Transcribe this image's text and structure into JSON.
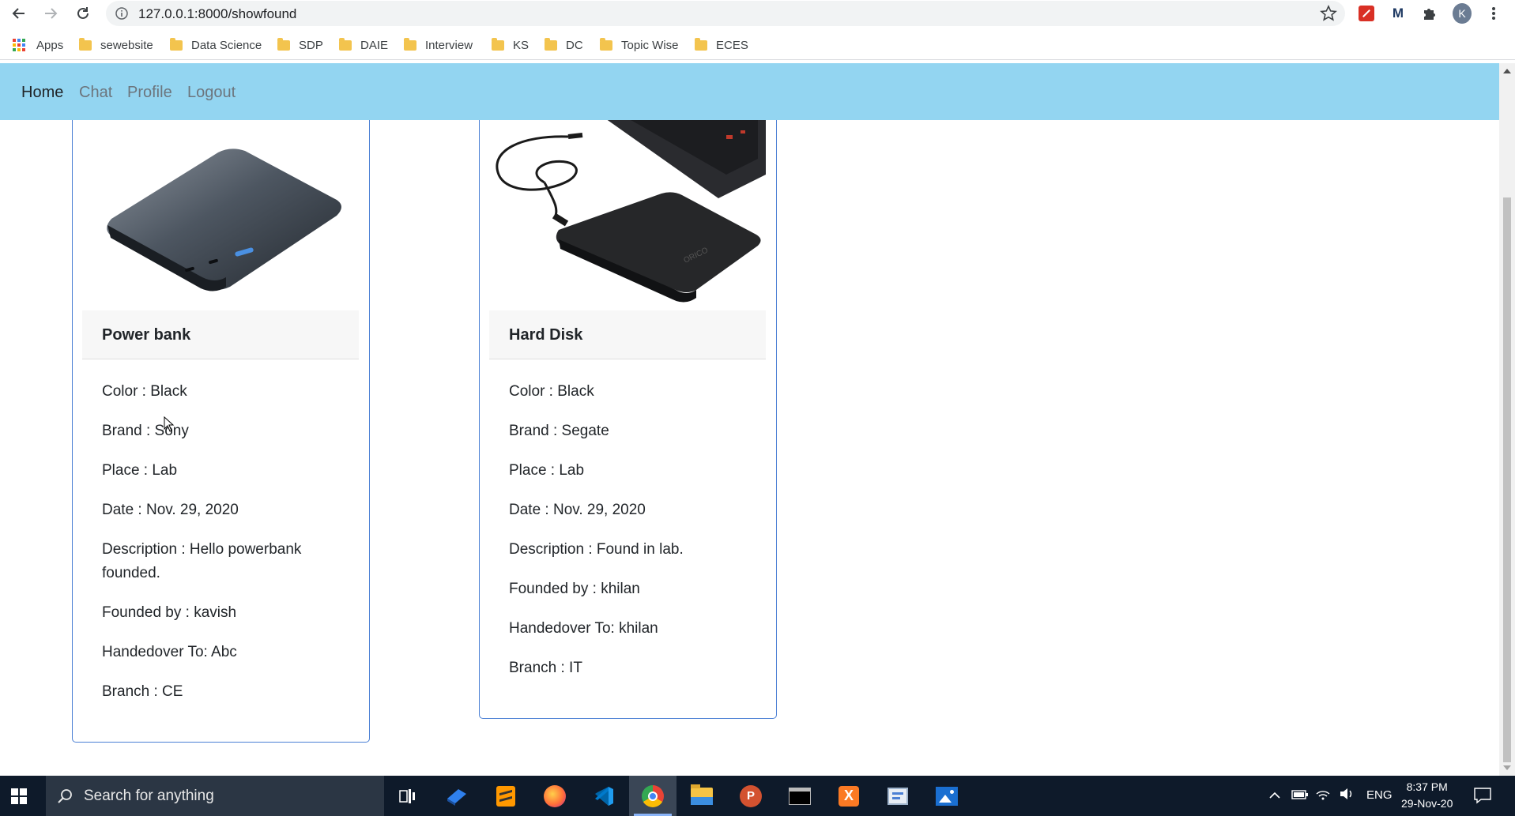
{
  "browser": {
    "url": "127.0.0.1:8000/showfound",
    "profile_initial": "K",
    "bookmarks": [
      "Apps",
      "sewebsite",
      "Data Science",
      "SDP",
      "DAIE",
      "Interview",
      "KS",
      "DC",
      "Topic Wise",
      "ECES"
    ]
  },
  "navbar": {
    "links": [
      "Home",
      "Chat",
      "Profile",
      "Logout"
    ],
    "color": "#93d5f1"
  },
  "items": [
    {
      "title": "Power bank",
      "image": "power-bank-photo",
      "fields": [
        "Color : Black",
        "Brand : Sony",
        "Place : Lab",
        "Date : Nov. 29, 2020",
        "Description : Hello powerbank",
        "founded.",
        "Founded by : kavish",
        "Handedover To: Abc",
        "Branch : CE"
      ]
    },
    {
      "title": "Hard Disk",
      "image": "hard-disk-photo",
      "fields": [
        "Color : Black",
        "Brand : Segate",
        "Place : Lab",
        "Date : Nov. 29, 2020",
        "Description : Found in lab.",
        "Founded by : khilan",
        "Handedover To: khilan",
        "Branch : IT"
      ]
    }
  ],
  "taskbar": {
    "search_placeholder": "Search for anything",
    "language": "ENG",
    "time": "8:37 PM",
    "date": "29-Nov-20"
  }
}
